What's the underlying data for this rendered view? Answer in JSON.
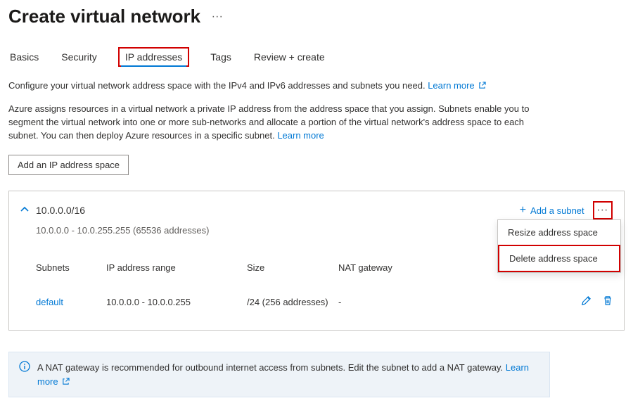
{
  "header": {
    "title": "Create virtual network"
  },
  "tabs": [
    "Basics",
    "Security",
    "IP addresses",
    "Tags",
    "Review + create"
  ],
  "active_tab": "IP addresses",
  "desc": {
    "line1_pre": "Configure your virtual network address space with the IPv4 and IPv6 addresses and subnets you need. ",
    "line1_link": "Learn more",
    "line2_pre": "Azure assigns resources in a virtual network a private IP address from the address space that you assign. Subnets enable you to segment the virtual network into one or more sub-networks and allocate a portion of the virtual network's address space to each subnet. You can then deploy Azure resources in a specific subnet. ",
    "line2_link": "Learn more"
  },
  "add_space_btn": "Add an IP address space",
  "space": {
    "cidr": "10.0.0.0/16",
    "range": "10.0.0.0 - 10.0.255.255 (65536 addresses)",
    "add_subnet_label": "Add a subnet"
  },
  "subnet_headers": {
    "name": "Subnets",
    "range": "IP address range",
    "size": "Size",
    "nat": "NAT gateway"
  },
  "subnet_row": {
    "name": "default",
    "range": "10.0.0.0 - 10.0.0.255",
    "size": "/24 (256 addresses)",
    "nat": "-"
  },
  "context_menu": {
    "resize": "Resize address space",
    "delete": "Delete address space"
  },
  "banner": {
    "text": "A NAT gateway is recommended for outbound internet access from subnets. Edit the subnet to add a NAT gateway.  ",
    "link": "Learn more"
  }
}
